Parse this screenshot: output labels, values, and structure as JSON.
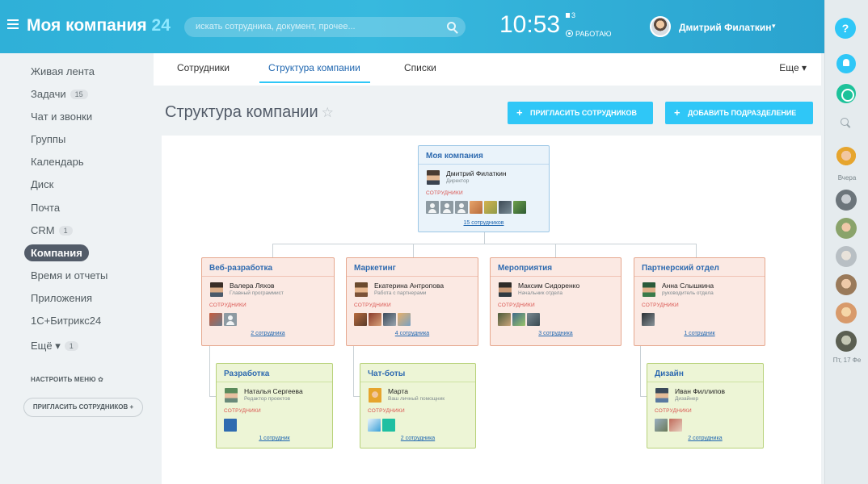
{
  "header": {
    "logo_name": "Моя компания",
    "logo_num": "24",
    "search_placeholder": "искать сотрудника, документ, прочее...",
    "clock": "10:53",
    "flag_count": "3",
    "work_status": "РАБОТАЮ",
    "user_name": "Дмитрий Филаткин",
    "user_caret": "▾"
  },
  "rightbar": {
    "help": "?",
    "label_yesterday": "Вчера",
    "label_date": "Пт, 17 Фе"
  },
  "sidebar": {
    "items": [
      {
        "label": "Живая лента"
      },
      {
        "label": "Задачи",
        "counter": "15"
      },
      {
        "label": "Чат и звонки"
      },
      {
        "label": "Группы"
      },
      {
        "label": "Календарь"
      },
      {
        "label": "Диск"
      },
      {
        "label": "Почта"
      },
      {
        "label": "CRM",
        "counter": "1"
      },
      {
        "label": "Компания"
      },
      {
        "label": "Время и отчеты"
      },
      {
        "label": "Приложения"
      },
      {
        "label": "1С+Битрикс24"
      },
      {
        "label": "Ещё ▾",
        "counter": "1"
      }
    ],
    "setup": "НАСТРОИТЬ МЕНЮ ✿",
    "invite": "ПРИГЛАСИТЬ СОТРУДНИКОВ +"
  },
  "tabs": {
    "items": [
      "Сотрудники",
      "Структура компании",
      "Списки"
    ],
    "more": "Еще ▾"
  },
  "page": {
    "title": "Структура компании",
    "star": "☆",
    "btn_invite": "ПРИГЛАСИТЬ СОТРУДНИКОВ",
    "btn_add": "ДОБАВИТЬ ПОДРАЗДЕЛЕНИЕ",
    "plus": "+"
  },
  "org": {
    "staff_label": "СОТРУДНИКИ",
    "root": {
      "title": "Моя компания",
      "head": "Дмитрий Филаткин",
      "role": "Директор",
      "count": "15 сотрудников"
    },
    "departments": [
      {
        "title": "Веб-разработка",
        "head": "Валера Ляхов",
        "role": "Главный программист",
        "count": "2 сотрудника"
      },
      {
        "title": "Маркетинг",
        "head": "Екатерина Антропова",
        "role": "Работа с партнерами",
        "count": "4 сотрудника"
      },
      {
        "title": "Мероприятия",
        "head": "Максим Сидоренко",
        "role": "Начальник отдела",
        "count": "3 сотрудника"
      },
      {
        "title": "Партнерский отдел",
        "head": "Анна Слышкина",
        "role": "руководитель отдела",
        "count": "1 сотрудник"
      }
    ],
    "subdivisions": [
      {
        "title": "Разработка",
        "head": "Наталья Сергеева",
        "role": "Редактор проектов",
        "count": "1 сотрудник"
      },
      {
        "title": "Чат-боты",
        "head": "Марта",
        "role": "Ваш личный помощник",
        "count": "2 сотрудника"
      },
      {
        "title": "Дизайн",
        "head": "Иван Филлипов",
        "role": "Дизайнер",
        "count": "2 сотрудника"
      }
    ]
  },
  "colors": {
    "accent": "#2fc7f7",
    "root_border": "#9cc7e6",
    "dep_border": "#e6a88f",
    "sub_border": "#b8d27a"
  }
}
